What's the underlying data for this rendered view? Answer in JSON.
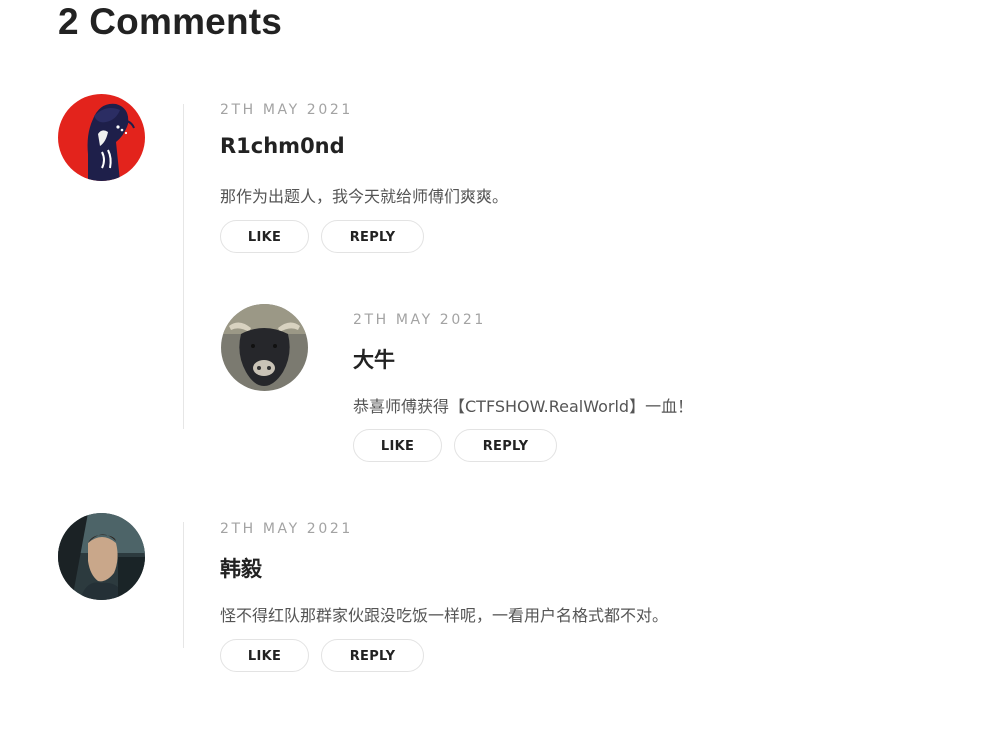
{
  "section": {
    "title": "2 Comments"
  },
  "comments": [
    {
      "date": "2TH MAY 2021",
      "author": "R1chm0nd",
      "text": "那作为出题人，我今天就给师傅们爽爽。",
      "like_label": "LIKE",
      "reply_label": "REPLY",
      "avatar": "red-anime-girl-avatar"
    },
    {
      "date": "2TH MAY 2021",
      "author": "大牛",
      "text": "恭喜师傅获得【CTFSHOW.RealWorld】一血！",
      "like_label": "LIKE",
      "reply_label": "REPLY",
      "avatar": "bull-avatar",
      "is_reply": true
    },
    {
      "date": "2TH MAY 2021",
      "author": "韩毅",
      "text": "怪不得红队那群家伙跟没吃饭一样呢，一看用户名格式都不对。",
      "like_label": "LIKE",
      "reply_label": "REPLY",
      "avatar": "man-in-car-avatar"
    }
  ],
  "colors": {
    "date": "#a3a3a3",
    "author": "#222222",
    "body": "#555555",
    "button_border": "#e3e3e3",
    "thread_line": "#e6e6e6"
  }
}
